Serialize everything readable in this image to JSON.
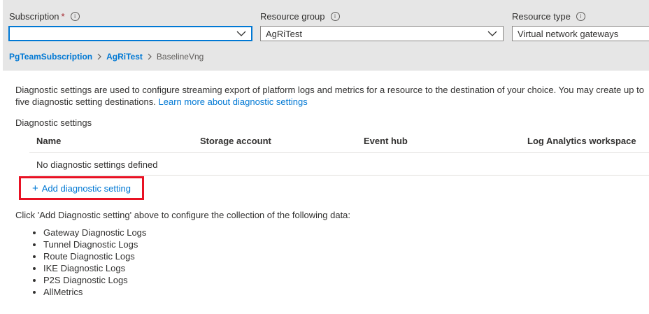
{
  "filters": {
    "subscription": {
      "label": "Subscription",
      "required_mark": "*",
      "value": ""
    },
    "resource_group": {
      "label": "Resource group",
      "value": "AgRiTest"
    },
    "resource_type": {
      "label": "Resource type",
      "value": "Virtual network gateways"
    },
    "info_glyph": "i"
  },
  "breadcrumb": [
    "PgTeamSubscription",
    "AgRiTest",
    "BaselineVng"
  ],
  "description": {
    "text": "Diagnostic settings are used to configure streaming export of platform logs and metrics for a resource to the destination of your choice. You may create up to five diagnostic setting destinations.",
    "link": "Learn more about diagnostic settings"
  },
  "diagnostic_settings": {
    "title": "Diagnostic settings",
    "columns": [
      "Name",
      "Storage account",
      "Event hub",
      "Log Analytics workspace"
    ],
    "empty_message": "No diagnostic settings defined",
    "add_button": {
      "icon": "+",
      "label": "Add diagnostic setting"
    }
  },
  "instructions": "Click 'Add Diagnostic setting' above to configure the collection of the following data:",
  "data_types": [
    "Gateway Diagnostic Logs",
    "Tunnel Diagnostic Logs",
    "Route Diagnostic Logs",
    "IKE Diagnostic Logs",
    "P2S Diagnostic Logs",
    "AllMetrics"
  ],
  "colors": {
    "accent": "#0078d4",
    "highlight": "#e81123",
    "filter_bar": "#e6e6e6"
  }
}
